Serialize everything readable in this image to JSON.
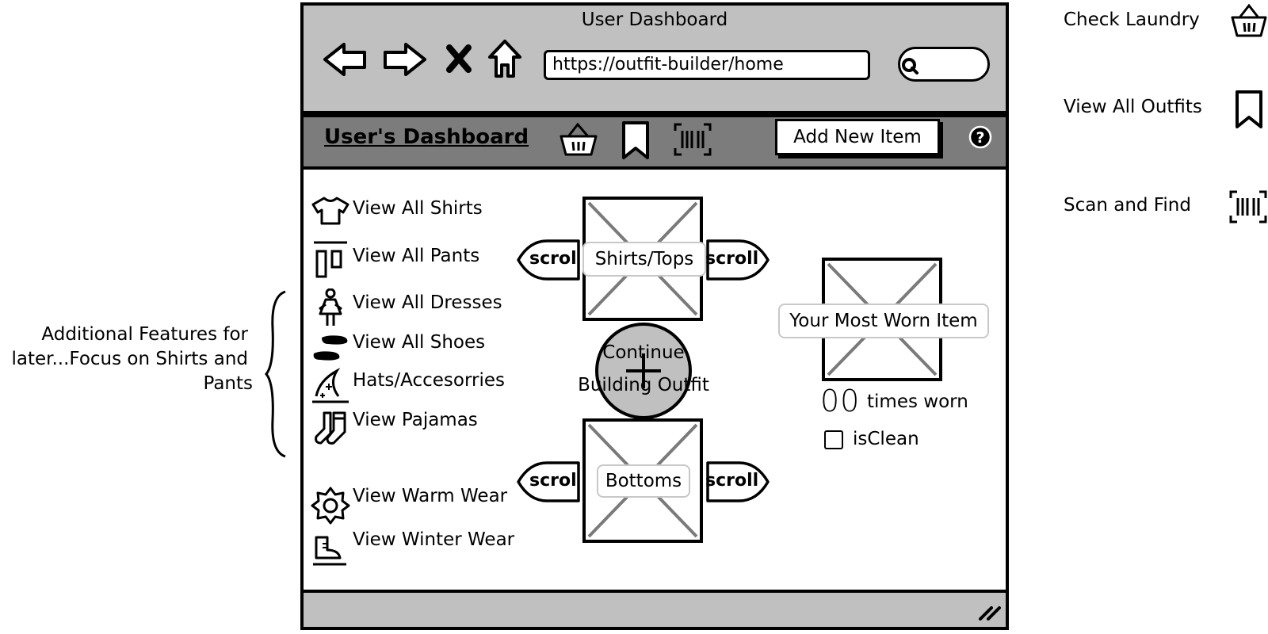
{
  "window": {
    "title": "User Dashboard",
    "url": "https://outfit-builder/home"
  },
  "navbar": {
    "title": "User's Dashboard",
    "add_item_label": "Add New Item",
    "help_label": "?"
  },
  "sidebar": {
    "items": [
      {
        "label": "View All Shirts",
        "icon": "shirt-icon"
      },
      {
        "label": "View All Pants",
        "icon": "pants-icon"
      },
      {
        "label": "View All Dresses",
        "icon": "dress-icon"
      },
      {
        "label": "View All Shoes",
        "icon": "shoes-icon"
      },
      {
        "label": "Hats/Accesorries",
        "icon": "hat-icon"
      },
      {
        "label": "View Pajamas",
        "icon": "socks-icon"
      },
      {
        "label": "View Warm Wear",
        "icon": "sun-icon"
      },
      {
        "label": "View Winter Wear",
        "icon": "skate-icon"
      }
    ]
  },
  "builder": {
    "tops_label": "Shirts/Tops",
    "bottoms_label": "Bottoms",
    "scroll_left": "scrol",
    "scroll_right": "scroll",
    "continue_line1": "Continue",
    "continue_line2": "Building Outfit"
  },
  "most_worn": {
    "label": "Your Most Worn Item",
    "count": "00",
    "count_suffix": "times worn",
    "clean_label": "isClean"
  },
  "annotation": {
    "line1": "Additional Features for",
    "line2": "later...Focus on Shirts and",
    "line3": "Pants"
  },
  "legend": [
    {
      "label": "Check Laundry",
      "icon": "basket-icon"
    },
    {
      "label": "View All Outfits",
      "icon": "bookmark-icon"
    },
    {
      "label": "Scan and Find",
      "icon": "barcode-icon"
    }
  ],
  "colors": {
    "chrome": "#c0c0c0",
    "navbar": "#7c7c7c",
    "placeholder_x": "#7a7a7a"
  }
}
